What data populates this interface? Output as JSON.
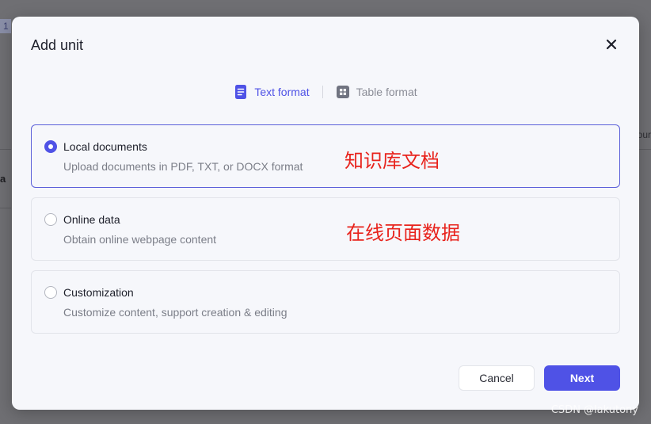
{
  "background": {
    "row_number": "1",
    "left_fragment": "a",
    "right_fragment": "our"
  },
  "modal": {
    "title": "Add unit",
    "close_icon": "close-icon",
    "tabs": [
      {
        "label": "Text format",
        "icon": "document-icon",
        "active": true
      },
      {
        "label": "Table format",
        "icon": "table-icon",
        "active": false
      }
    ],
    "options": [
      {
        "title": "Local documents",
        "description": "Upload documents in PDF, TXT, or DOCX format",
        "selected": true,
        "annotation": "知识库文档"
      },
      {
        "title": "Online data",
        "description": "Obtain online webpage content",
        "selected": false,
        "annotation": "在线页面数据"
      },
      {
        "title": "Customization",
        "description": "Customize content, support creation & editing",
        "selected": false
      }
    ],
    "buttons": {
      "cancel": "Cancel",
      "next": "Next"
    }
  },
  "watermark": "CSDN @lakutony",
  "colors": {
    "accent": "#4f52e6",
    "annotation": "#e8231c",
    "overlay": "#6f6f73",
    "modal_bg": "#f6f7fb"
  }
}
